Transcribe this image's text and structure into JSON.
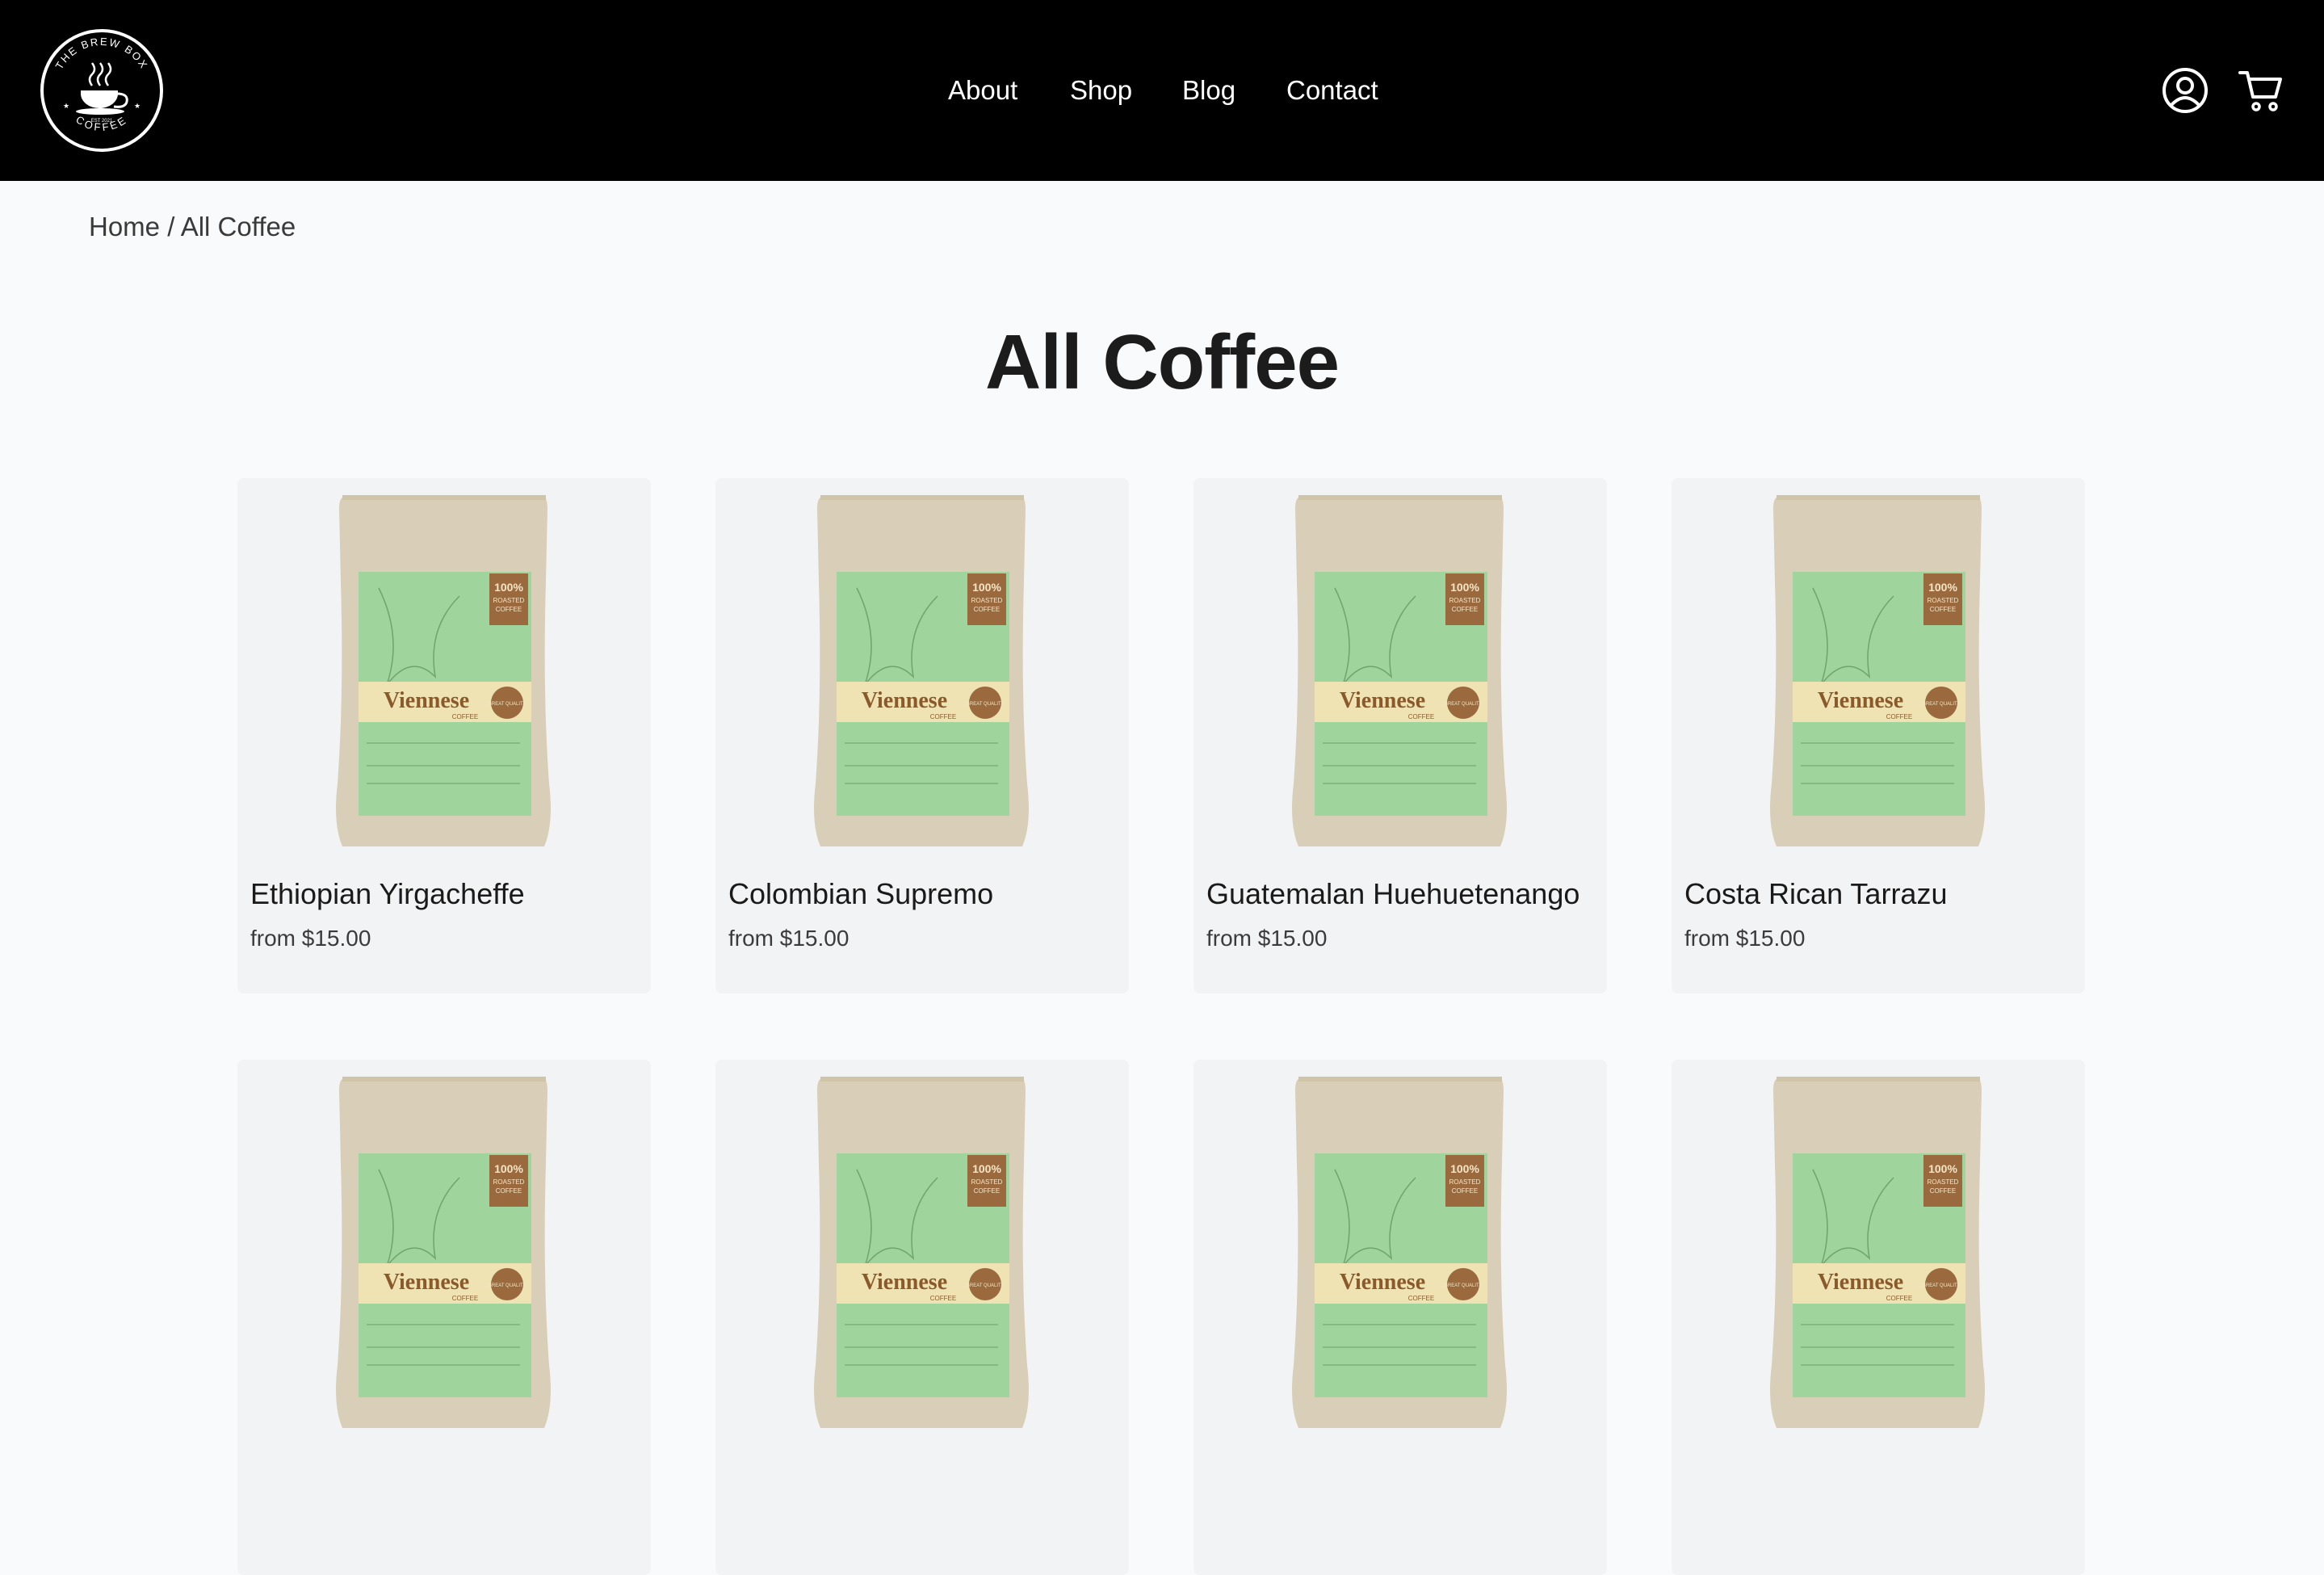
{
  "brand": {
    "logo_text_top": "THE BREW BOX",
    "logo_text_bottom": "COFFEE",
    "logo_est": "EST 2021"
  },
  "nav": [
    {
      "label": "About"
    },
    {
      "label": "Shop"
    },
    {
      "label": "Blog"
    },
    {
      "label": "Contact"
    }
  ],
  "header_icons": [
    "account-icon",
    "cart-icon"
  ],
  "breadcrumb": {
    "home": "Home",
    "separator": " / ",
    "current": "All Coffee"
  },
  "page_title": "All Coffee",
  "package_label": {
    "badge": "100%",
    "badge_sub1": "ROASTED",
    "badge_sub2": "COFFEE",
    "brand": "Viennese",
    "brand_sub": "COFFEE",
    "seal": "GREAT QUALITY"
  },
  "products": [
    {
      "name": "Ethiopian Yirgacheffe",
      "price": "from $15.00"
    },
    {
      "name": "Colombian Supremo",
      "price": "from $15.00"
    },
    {
      "name": "Guatemalan Huehuetenango",
      "price": "from $15.00"
    },
    {
      "name": "Costa Rican Tarrazu",
      "price": "from $15.00"
    },
    {
      "name": "",
      "price": ""
    },
    {
      "name": "",
      "price": ""
    },
    {
      "name": "",
      "price": ""
    },
    {
      "name": "",
      "price": ""
    }
  ],
  "colors": {
    "header_bg": "#000000",
    "page_bg": "#f9fafb",
    "card_bg": "#f2f3f5",
    "bag_kraft": "#d8cdb5",
    "bag_label": "#9ed49c",
    "badge_brown": "#9a6a3e"
  }
}
